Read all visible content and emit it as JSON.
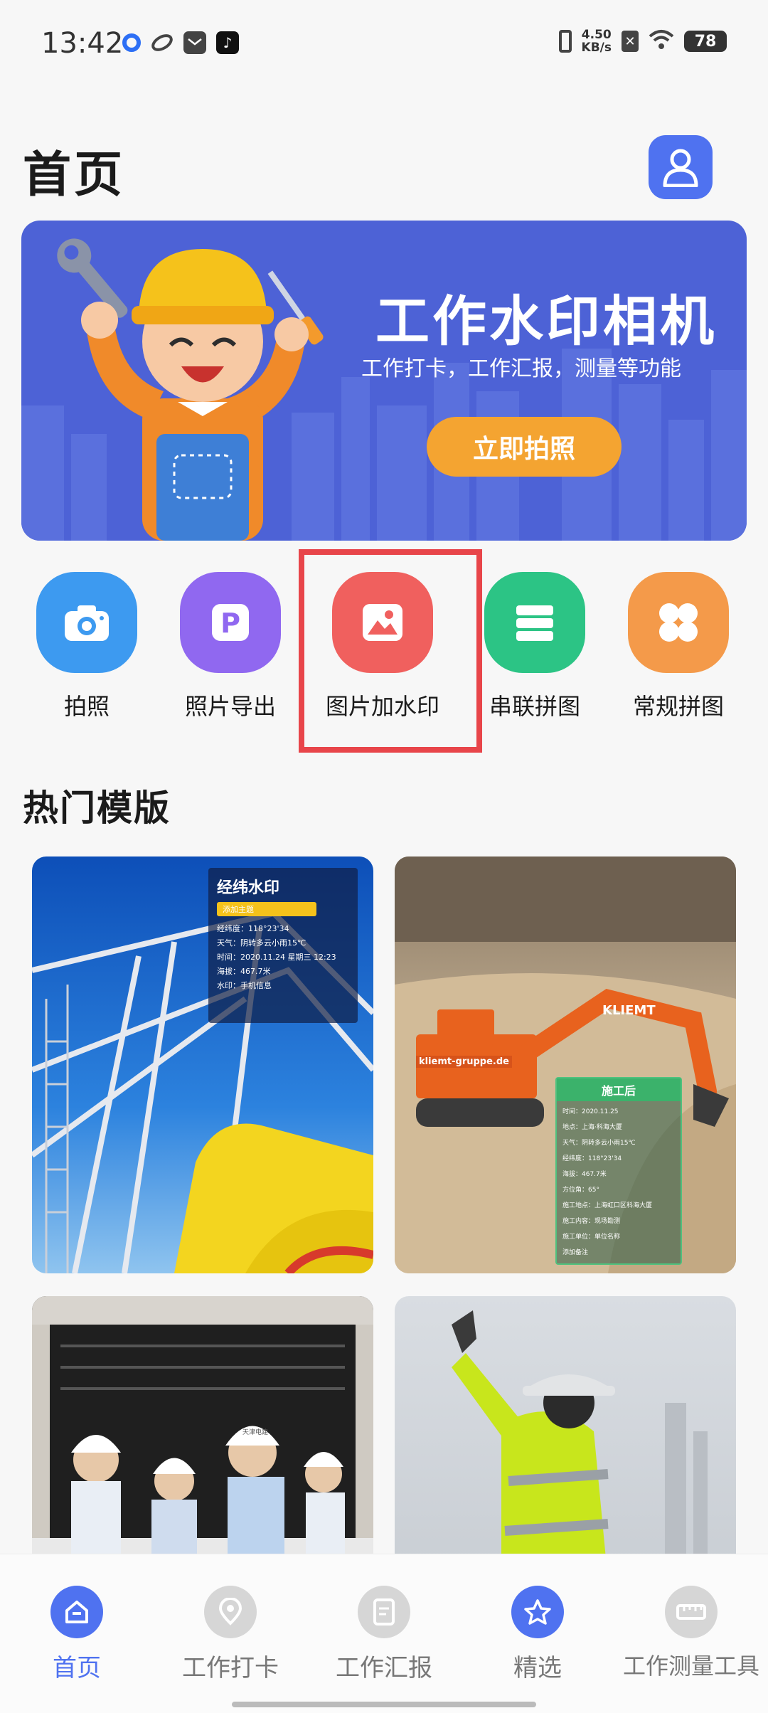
{
  "status_bar": {
    "time": "13:42",
    "speed_value": "4.50",
    "speed_unit": "KB/s",
    "battery": "78",
    "left_icons": [
      "record-icon",
      "browser-icon",
      "message-icon",
      "tiktok-icon"
    ],
    "right_icons": [
      "vibrate-icon",
      "sim-off-icon",
      "wifi-icon"
    ]
  },
  "header": {
    "title": "首页",
    "avatar_icon": "user-icon"
  },
  "banner": {
    "title": "工作水印相机",
    "subtitle": "工作打卡，工作汇报，测量等功能",
    "button_label": "立即拍照"
  },
  "quick_actions": [
    {
      "label": "拍照",
      "icon": "camera-icon",
      "color": "#3d9af0"
    },
    {
      "label": "照片导出",
      "icon": "p-icon",
      "color": "#9068f0"
    },
    {
      "label": "图片加水印",
      "icon": "image-icon",
      "color": "#f0605e"
    },
    {
      "label": "串联拼图",
      "icon": "stack-icon",
      "color": "#2cc485"
    },
    {
      "label": "常规拼图",
      "icon": "grid-icon",
      "color": "#f49a4a"
    }
  ],
  "section": {
    "title": "热门模版"
  },
  "templates": {
    "card1": {
      "title": "经纬水印",
      "tag": "添加主题",
      "lines": [
        "经纬度：118°23'34",
        "天气：阴转多云小雨15℃",
        "时间：2020.11.24 星期三 12:23",
        "海拔：467.7米",
        "水印：手机信息"
      ]
    },
    "card2": {
      "title": "施工后",
      "brand": "KLIEMT",
      "site": "kliemt-gruppe.de",
      "lines": [
        "时间：2020.11.25",
        "地点：上海·科海大厦",
        "天气：阴转多云小雨15℃",
        "经纬度：118°23'34",
        "海拔：467.7米",
        "方位角：65°",
        "施工地点：上海虹口区科海大厦",
        "施工内容：现场勘测",
        "施工单位：单位名称",
        "添加备注"
      ]
    },
    "card3": {
      "helmet_text": "天津电建"
    }
  },
  "bottom_nav": [
    {
      "label": "首页",
      "icon": "home-icon",
      "active": true
    },
    {
      "label": "工作打卡",
      "icon": "location-icon",
      "active": false
    },
    {
      "label": "工作汇报",
      "icon": "report-icon",
      "active": false
    },
    {
      "label": "精选",
      "icon": "star-icon",
      "active": false
    },
    {
      "label": "工作测量工具",
      "icon": "ruler-icon",
      "active": false
    }
  ],
  "colors": {
    "primary": "#4f72f0",
    "banner": "#4d62d6",
    "accent": "#f4a431",
    "highlight": "#e8454a",
    "active_nav": "#4f72f0",
    "inactive_nav": "#777777"
  }
}
